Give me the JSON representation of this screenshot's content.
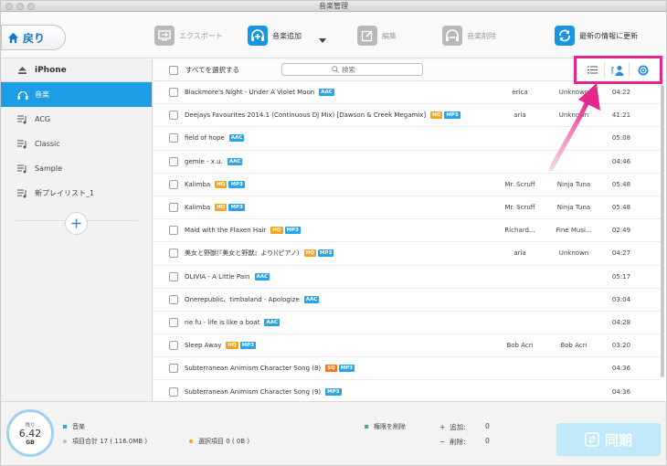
{
  "window": {
    "title": "音楽管理"
  },
  "toolbar": {
    "back_label": "戻り",
    "export_label": "エクスポート",
    "add_label": "音楽追加",
    "edit_label": "編集",
    "delete_label": "音楽削除",
    "refresh_label": "最新の情報に更新"
  },
  "sidebar": {
    "device": "iPhone",
    "items": [
      {
        "label": "音楽",
        "icon": "headphones-icon",
        "selected": true
      },
      {
        "label": "ACG",
        "icon": "playlist-icon",
        "selected": false
      },
      {
        "label": "Classic",
        "icon": "playlist-icon",
        "selected": false
      },
      {
        "label": "Sample",
        "icon": "playlist-icon",
        "selected": false
      },
      {
        "label": "新プレイリスト_1",
        "icon": "playlist-icon",
        "selected": false
      }
    ]
  },
  "list": {
    "select_all_label": "すべてを選択する",
    "search_placeholder": "検索",
    "rows": [
      {
        "title": "Blackmore's Night - Under A Violet Moon",
        "tags": [
          "AAC"
        ],
        "artist": "erica",
        "album": "Unknown",
        "time": "04:22"
      },
      {
        "title": "Deejays Favourites 2014.1 (Continuous DJ Mix) [Dawson & Creek Megamix]",
        "tags": [
          "HQ",
          "MP3"
        ],
        "artist": "aria",
        "album": "Unknown",
        "time": "41:21"
      },
      {
        "title": "field of hope",
        "tags": [
          "AAC"
        ],
        "artist": "",
        "album": "",
        "time": "05:08"
      },
      {
        "title": "gemie - x.u.",
        "tags": [
          "AAC"
        ],
        "artist": "",
        "album": "",
        "time": "04:46"
      },
      {
        "title": "Kalimba",
        "tags": [
          "HQ",
          "MP3"
        ],
        "artist": "Mr. Scruff",
        "album": "Ninja Tuna",
        "time": "05:48"
      },
      {
        "title": "Kalimba",
        "tags": [
          "HQ",
          "MP3"
        ],
        "artist": "Mr. Scruff",
        "album": "Ninja Tuna",
        "time": "05:48"
      },
      {
        "title": "Maid with the Flaxen Hair",
        "tags": [
          "HQ",
          "MP3"
        ],
        "artist": "Richard...",
        "album": "Fine Musi...",
        "time": "02:49"
      },
      {
        "title": "美女と野獣(『美女と野獣』より)(ピアノ)",
        "tags": [
          "HQ",
          "MP3"
        ],
        "artist": "aria",
        "album": "Unknown",
        "time": "04:27"
      },
      {
        "title": "OLIVIA - A Little Pain",
        "tags": [
          "AAC"
        ],
        "artist": "",
        "album": "",
        "time": "05:17"
      },
      {
        "title": "Onerepublic、timbaland - Apologize",
        "tags": [
          "AAC"
        ],
        "artist": "",
        "album": "",
        "time": "03:04"
      },
      {
        "title": "rie fu - life is like a boat",
        "tags": [
          "AAC"
        ],
        "artist": "",
        "album": "",
        "time": "04:28"
      },
      {
        "title": "Sleep Away",
        "tags": [
          "HQ",
          "MP3"
        ],
        "artist": "Bob Acri",
        "album": "Bob Acri",
        "time": "03:20"
      },
      {
        "title": "Subterranean Animism Character Song (8)",
        "tags": [
          "SQ",
          "MP3"
        ],
        "artist": "",
        "album": "",
        "time": "04:36"
      },
      {
        "title": "Subterranean Animism Character Song (9)",
        "tags": [
          "MP3"
        ],
        "artist": "",
        "album": "",
        "time": "04:36"
      }
    ]
  },
  "footer": {
    "storage_label": "残り",
    "storage_value": "6.42",
    "storage_unit": "GB",
    "music_label": "音楽",
    "total_label": "項目合計 17 ( 116.0MB )",
    "selected_label": "選択項目 0 ( 0B )",
    "delete_rights_label": "権限を削除",
    "add_label": "追加:",
    "add_count": "0",
    "remove_label": "削除:",
    "remove_count": "0",
    "sync_label": "同期"
  },
  "colors": {
    "accent": "#1d9de5",
    "annotation": "#e3278c",
    "tag_aac": "#2aa4e8",
    "tag_hq": "#f2a51c",
    "tag_sq": "#f07b1f",
    "legend_music": "#2aa4e8",
    "legend_total": "#bdbdbd",
    "legend_selected": "#f2a51c",
    "legend_delete": "#39b86b"
  }
}
